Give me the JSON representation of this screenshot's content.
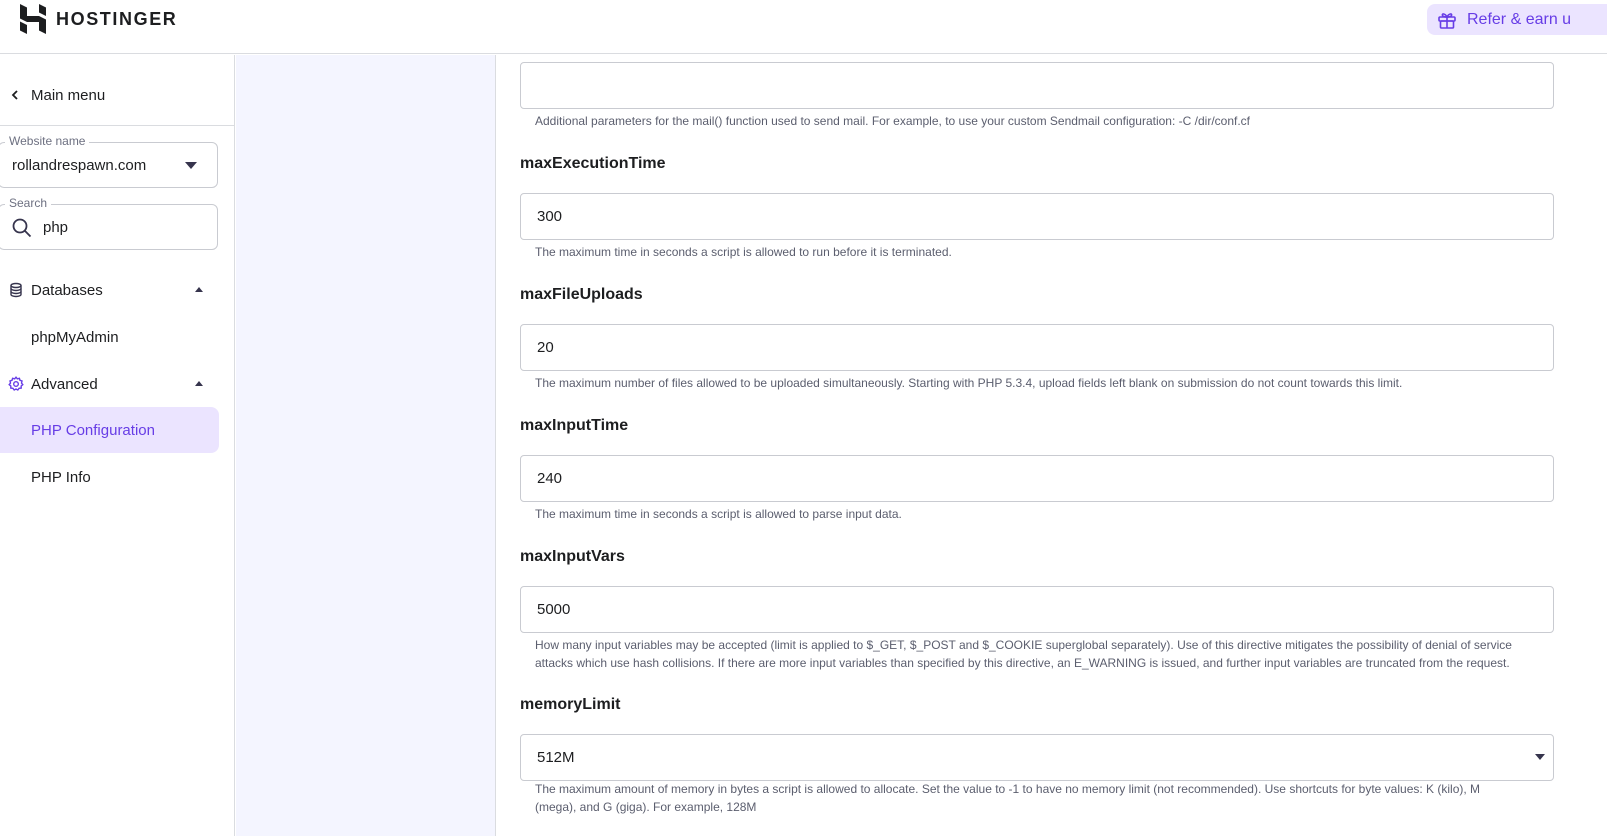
{
  "header": {
    "brand": "HOSTINGER",
    "refer_label": "Refer & earn u"
  },
  "sidebar": {
    "main_menu_label": "Main menu",
    "website": {
      "label": "Website name",
      "value": "rollandrespawn.com"
    },
    "search": {
      "label": "Search",
      "value": "php"
    },
    "items": [
      {
        "label": "Databases",
        "icon": "database-icon",
        "expanded": true
      },
      {
        "label": "phpMyAdmin"
      },
      {
        "label": "Advanced",
        "icon": "gear-icon",
        "expanded": true
      },
      {
        "label": "PHP Configuration",
        "active": true
      },
      {
        "label": "PHP Info"
      }
    ]
  },
  "settings": [
    {
      "name": "",
      "value": "",
      "help": "Additional parameters for the mail() function used to send mail. For example, to use your custom Sendmail configuration: -C /dir/conf.cf"
    },
    {
      "name": "maxExecutionTime",
      "value": "300",
      "help": "The maximum time in seconds a script is allowed to run before it is terminated."
    },
    {
      "name": "maxFileUploads",
      "value": "20",
      "help": "The maximum number of files allowed to be uploaded simultaneously. Starting with PHP 5.3.4, upload fields left blank on submission do not count towards this limit."
    },
    {
      "name": "maxInputTime",
      "value": "240",
      "help": "The maximum time in seconds a script is allowed to parse input data."
    },
    {
      "name": "maxInputVars",
      "value": "5000",
      "help": "How many input variables may be accepted (limit is applied to $_GET, $_POST and $_COOKIE superglobal separately). Use of this directive mitigates the possibility of denial of service attacks which use hash collisions. If there are more input variables than specified by this directive, an E_WARNING is issued, and further input variables are truncated from the request."
    },
    {
      "name": "memoryLimit",
      "value": "512M",
      "help": "The maximum amount of memory in bytes a script is allowed to allocate. Set the value to -1 to have no memory limit (not recommended). Use shortcuts for byte values: K (kilo), M (mega), and G (giga). For example, 128M"
    }
  ],
  "colors": {
    "accent": "#673de6",
    "accent_bg": "#ebe4ff",
    "gutter_bg": "#f4f5ff",
    "border": "#dadce0"
  }
}
